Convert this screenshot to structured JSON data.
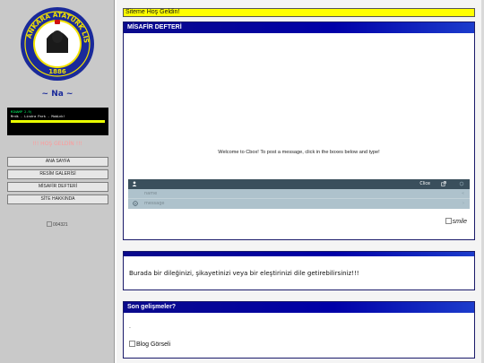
{
  "sidebar": {
    "site_name": "~ Na ~",
    "player": {
      "line1": "MINAMP 2.9)",
      "line2": "Mrdk - Lindra Park - MobLnk!"
    },
    "welcome_note": "!!! HOŞ GELDİN !!!",
    "nav": [
      {
        "label": "ANA SAYFA"
      },
      {
        "label": "RESİM GALERİSİ"
      },
      {
        "label": "MİSAFİR DEFTERİ"
      },
      {
        "label": "SİTE HAKKINDA"
      }
    ],
    "counter_alt": "004321"
  },
  "logo": {
    "ring_text": "ANKARA ATATÜRK LİSESİ",
    "year": "1886",
    "colors": {
      "ring": "#1a2a9a",
      "inner": "#f2e200",
      "bg": "#ffffff"
    }
  },
  "banner": {
    "text": "Siteme Hoş Geldin!"
  },
  "guestbook": {
    "title": "MİSAFİR DEFTERİ",
    "cbox_welcome": "Welcome to Cbox! To post a message, click in the boxes below and type!",
    "clear_label": "Clice",
    "name_placeholder": "name",
    "message_placeholder": "message",
    "smile_alt": "smile"
  },
  "wish": {
    "text": "Burada bir dileğinizi, şikayetinizi veya bir eleştirinizi dile getirebilirsiniz!!!"
  },
  "news": {
    "title": "Son gelişmeler?",
    "dot": ".",
    "image_alt": "Blog Görseli"
  },
  "colors": {
    "header_blue": "#0000a8",
    "banner_yellow": "#ffff00",
    "sidebar_gray": "#c9c9c9",
    "cbox_bar": "#3a4f5c",
    "cbox_form": "#aec2cc"
  }
}
